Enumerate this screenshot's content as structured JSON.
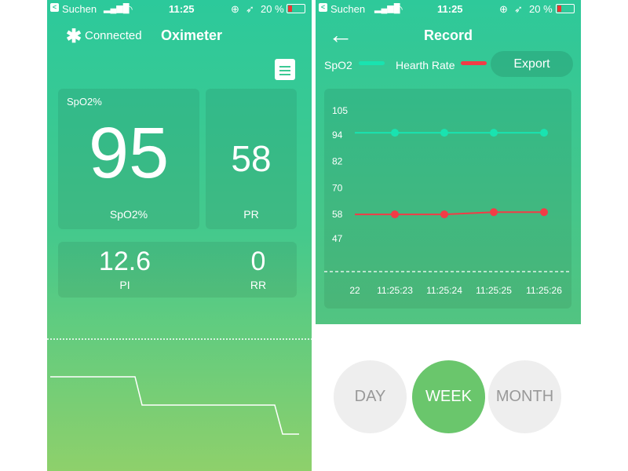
{
  "status_bar": {
    "back_label": "Suchen",
    "time": "11:25",
    "battery": "20 %",
    "battery_level": 0.2
  },
  "oximeter": {
    "connection": "Connected",
    "title": "Oximeter",
    "spo2_header": "SpO2%",
    "spo2_value": "95",
    "spo2_label": "SpO2%",
    "pr_value": "58",
    "pr_label": "PR",
    "pi_value": "12.6",
    "pi_label": "PI",
    "rr_value": "0",
    "rr_label": "RR"
  },
  "record": {
    "title": "Record",
    "export_label": "Export",
    "periods": [
      {
        "label": "DAY",
        "active": false
      },
      {
        "label": "WEEK",
        "active": true
      },
      {
        "label": "MONTH",
        "active": false
      }
    ]
  },
  "chart_data": {
    "type": "line",
    "x": [
      "11:25:22",
      "11:25:23",
      "11:25:24",
      "11:25:25",
      "11:25:26"
    ],
    "x_tick_labels": [
      "22",
      "11:25:23",
      "11:25:24",
      "11:25:25",
      "11:25:26"
    ],
    "y_ticks": [
      105,
      94,
      82,
      70,
      58,
      47
    ],
    "ylim": [
      47,
      105
    ],
    "legend_placement": "top",
    "series": [
      {
        "name": "SpO2",
        "color": "#19e3b0",
        "values": [
          95,
          95,
          95,
          95
        ]
      },
      {
        "name": "Hearth Rate",
        "color": "#f23c46",
        "values": [
          58,
          58,
          59,
          59
        ]
      }
    ]
  }
}
